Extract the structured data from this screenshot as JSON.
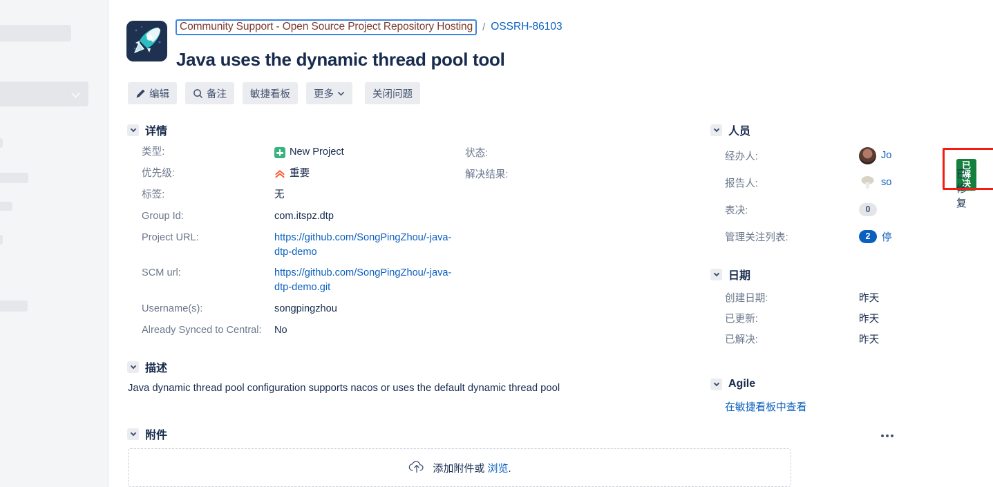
{
  "breadcrumb": {
    "project_link": "Community Support - Open Source Project Repository Hosting",
    "separator": "/",
    "issue_key": "OSSRH-86103"
  },
  "issue": {
    "title": "Java uses the dynamic thread pool tool",
    "project_icon": "rocket-icon"
  },
  "toolbar": {
    "edit_label": "编辑",
    "comment_label": "备注",
    "agile_board_label": "敏捷看板",
    "more_label": "更多",
    "close_issue_label": "关闭问题"
  },
  "details": {
    "section_title": "详情",
    "left_fields": [
      {
        "label": "类型:",
        "value": "New Project",
        "icon": "new-project-icon"
      },
      {
        "label": "优先级:",
        "value": "重要",
        "icon": "major-priority-icon"
      },
      {
        "label": "标签:",
        "value": "无"
      },
      {
        "label": "Group Id:",
        "value": "com.itspz.dtp"
      },
      {
        "label": "Project URL:",
        "value": "https://github.com/SongPingZhou/-java-dtp-demo",
        "link": true
      },
      {
        "label": "SCM url:",
        "value": "https://github.com/SongPingZhou/-java-dtp-demo.git",
        "link": true
      },
      {
        "label": "Username(s):",
        "value": "songpingzhou"
      },
      {
        "label": "Already Synced to Central:",
        "value": "No"
      }
    ],
    "status": {
      "label": "状态:",
      "value": "已解决"
    },
    "resolution": {
      "label": "解决结果:",
      "value": "已修复"
    },
    "highlight_color": "#f41c12",
    "status_badge_color": "#15803d"
  },
  "description": {
    "section_title": "描述",
    "body": "Java dynamic thread pool configuration supports nacos or uses the default dynamic thread pool"
  },
  "attachments": {
    "section_title": "附件",
    "more_icon": "ellipsis-icon",
    "dropzone_text": "添加附件或",
    "dropzone_link": "浏览",
    "dropzone_suffix": ".",
    "upload_icon": "cloud-upload-icon"
  },
  "people": {
    "section_title": "人员",
    "rows": [
      {
        "label": "经办人:",
        "value": "Jo",
        "avatar": "assignee-avatar"
      },
      {
        "label": "报告人:",
        "value": "so",
        "avatar": "reporter-avatar"
      },
      {
        "label": "表决:",
        "value": "0",
        "pill": "grey"
      },
      {
        "label": "管理关注列表:",
        "value": "2",
        "pill": "blue",
        "extra": "停"
      }
    ]
  },
  "dates": {
    "section_title": "日期",
    "rows": [
      {
        "label": "创建日期:",
        "value": "昨天"
      },
      {
        "label": "已更新:",
        "value": "昨天"
      },
      {
        "label": "已解决:",
        "value": "昨天"
      }
    ]
  },
  "agile": {
    "section_title": "Agile",
    "link_label": "在敏捷看板中查看"
  }
}
